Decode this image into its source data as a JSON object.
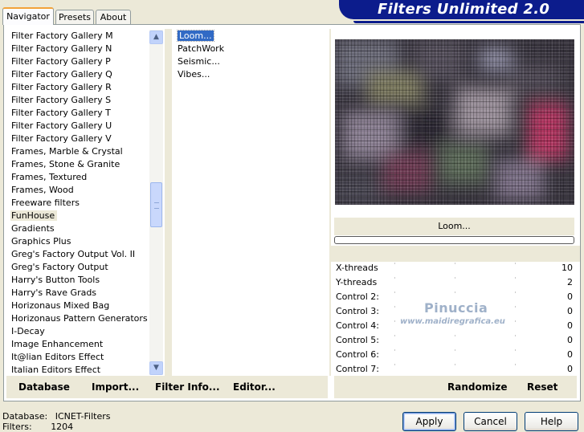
{
  "tabs": [
    {
      "label": "Navigator",
      "active": true
    },
    {
      "label": "Presets",
      "active": false
    },
    {
      "label": "About",
      "active": false
    }
  ],
  "banner_title": "Filters Unlimited 2.0",
  "categories": [
    "Filter Factory Gallery M",
    "Filter Factory Gallery N",
    "Filter Factory Gallery P",
    "Filter Factory Gallery Q",
    "Filter Factory Gallery R",
    "Filter Factory Gallery S",
    "Filter Factory Gallery T",
    "Filter Factory Gallery U",
    "Filter Factory Gallery V",
    "Frames, Marble & Crystal",
    "Frames, Stone & Granite",
    "Frames, Textured",
    "Frames, Wood",
    "Freeware filters",
    "FunHouse",
    "Gradients",
    "Graphics Plus",
    "Greg's Factory Output Vol. II",
    "Greg's Factory Output",
    "Harry's Button Tools",
    "Harry's Rave Grads",
    "Horizonaus Mixed Bag",
    "Horizonaus Pattern Generators",
    "I-Decay",
    "Image Enhancement",
    "It@lian Editors Effect",
    "Italian Editors Effect"
  ],
  "selected_category": "FunHouse",
  "filters": [
    "Loom...",
    "PatchWork",
    "Seismic...",
    "Vibes..."
  ],
  "selected_filter": "Loom...",
  "current_filter_name": "Loom...",
  "progress": 0,
  "controls": [
    {
      "label": "X-threads",
      "value": "10"
    },
    {
      "label": "Y-threads",
      "value": "2"
    },
    {
      "label": "Control 2:",
      "value": "0"
    },
    {
      "label": "Control 3:",
      "value": "0"
    },
    {
      "label": "Control 4:",
      "value": "0"
    },
    {
      "label": "Control 5:",
      "value": "0"
    },
    {
      "label": "Control 6:",
      "value": "0"
    },
    {
      "label": "Control 7:",
      "value": "0"
    }
  ],
  "watermark": {
    "line1": "Pinuccia",
    "line2": "www.maidiregrafica.eu"
  },
  "toolbar": {
    "database": "Database",
    "import": "Import...",
    "filter_info": "Filter Info...",
    "editor": "Editor...",
    "randomize": "Randomize",
    "reset": "Reset"
  },
  "status": {
    "database_label": "Database:",
    "database_value": "ICNET-Filters",
    "filters_label": "Filters:",
    "filters_value": "1204"
  },
  "buttons": {
    "apply": "Apply",
    "cancel": "Cancel",
    "help": "Help"
  },
  "icons": {
    "scroll_up": "arrow-up-icon",
    "scroll_down": "arrow-down-icon"
  }
}
